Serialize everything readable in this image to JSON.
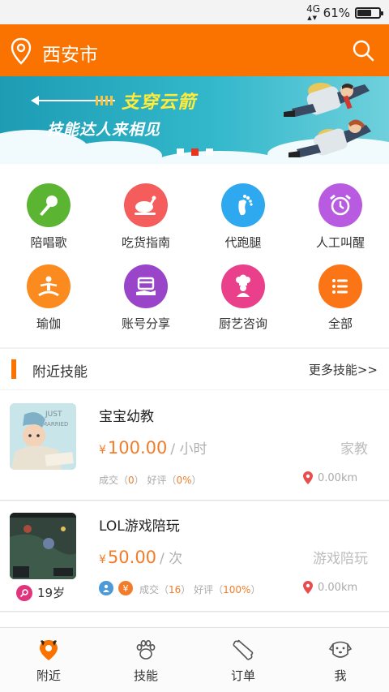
{
  "status_bar": {
    "network": "4G",
    "battery": "61%"
  },
  "header": {
    "city": "西安市"
  },
  "banner": {
    "title": "支穿云箭",
    "subtitle": "技能达人来相见",
    "active_slide": 2,
    "slide_count": 3
  },
  "categories": [
    {
      "label": "陪唱歌",
      "icon": "microphone-icon",
      "color": "#5bb533"
    },
    {
      "label": "吃货指南",
      "icon": "roast-chicken-icon",
      "color": "#f45d5b"
    },
    {
      "label": "代跑腿",
      "icon": "footprint-icon",
      "color": "#2ea8ef"
    },
    {
      "label": "人工叫醒",
      "icon": "alarm-clock-icon",
      "color": "#b85be0"
    },
    {
      "label": "瑜伽",
      "icon": "yoga-icon",
      "color": "#fb8a1f"
    },
    {
      "label": "账号分享",
      "icon": "account-card-icon",
      "color": "#9a45c9"
    },
    {
      "label": "厨艺咨询",
      "icon": "chef-icon",
      "color": "#ea3f8b"
    },
    {
      "label": "全部",
      "icon": "list-icon",
      "color": "#fb7416"
    }
  ],
  "section": {
    "title": "附近技能",
    "more": "更多技能>>"
  },
  "skills": [
    {
      "title": "宝宝幼教",
      "currency": "¥",
      "price": "100.00",
      "unit": "/ 小时",
      "tag": "家教",
      "deals_label": "成交（",
      "deals": "0",
      "rating_label": "）   好评（",
      "rating": "0%",
      "close": "）",
      "distance": "0.00km"
    },
    {
      "title": "LOL游戏陪玩",
      "currency": "¥",
      "price": "50.00",
      "unit": "/ 次",
      "tag": "游戏陪玩",
      "age": "19岁",
      "deals_label": "成交（",
      "deals": "16",
      "rating_label": "）   好评（",
      "rating": "100%",
      "close": "）",
      "distance": "0.00km"
    }
  ],
  "nav": [
    {
      "label": "附近",
      "icon": "location-icon",
      "active": true
    },
    {
      "label": "技能",
      "icon": "paw-icon",
      "active": false
    },
    {
      "label": "订单",
      "icon": "bone-icon",
      "active": false
    },
    {
      "label": "我",
      "icon": "dog-face-icon",
      "active": false
    }
  ],
  "colors": {
    "brand": "#fa7300",
    "price": "#f17d2a",
    "banner": "#1d9cb4"
  }
}
